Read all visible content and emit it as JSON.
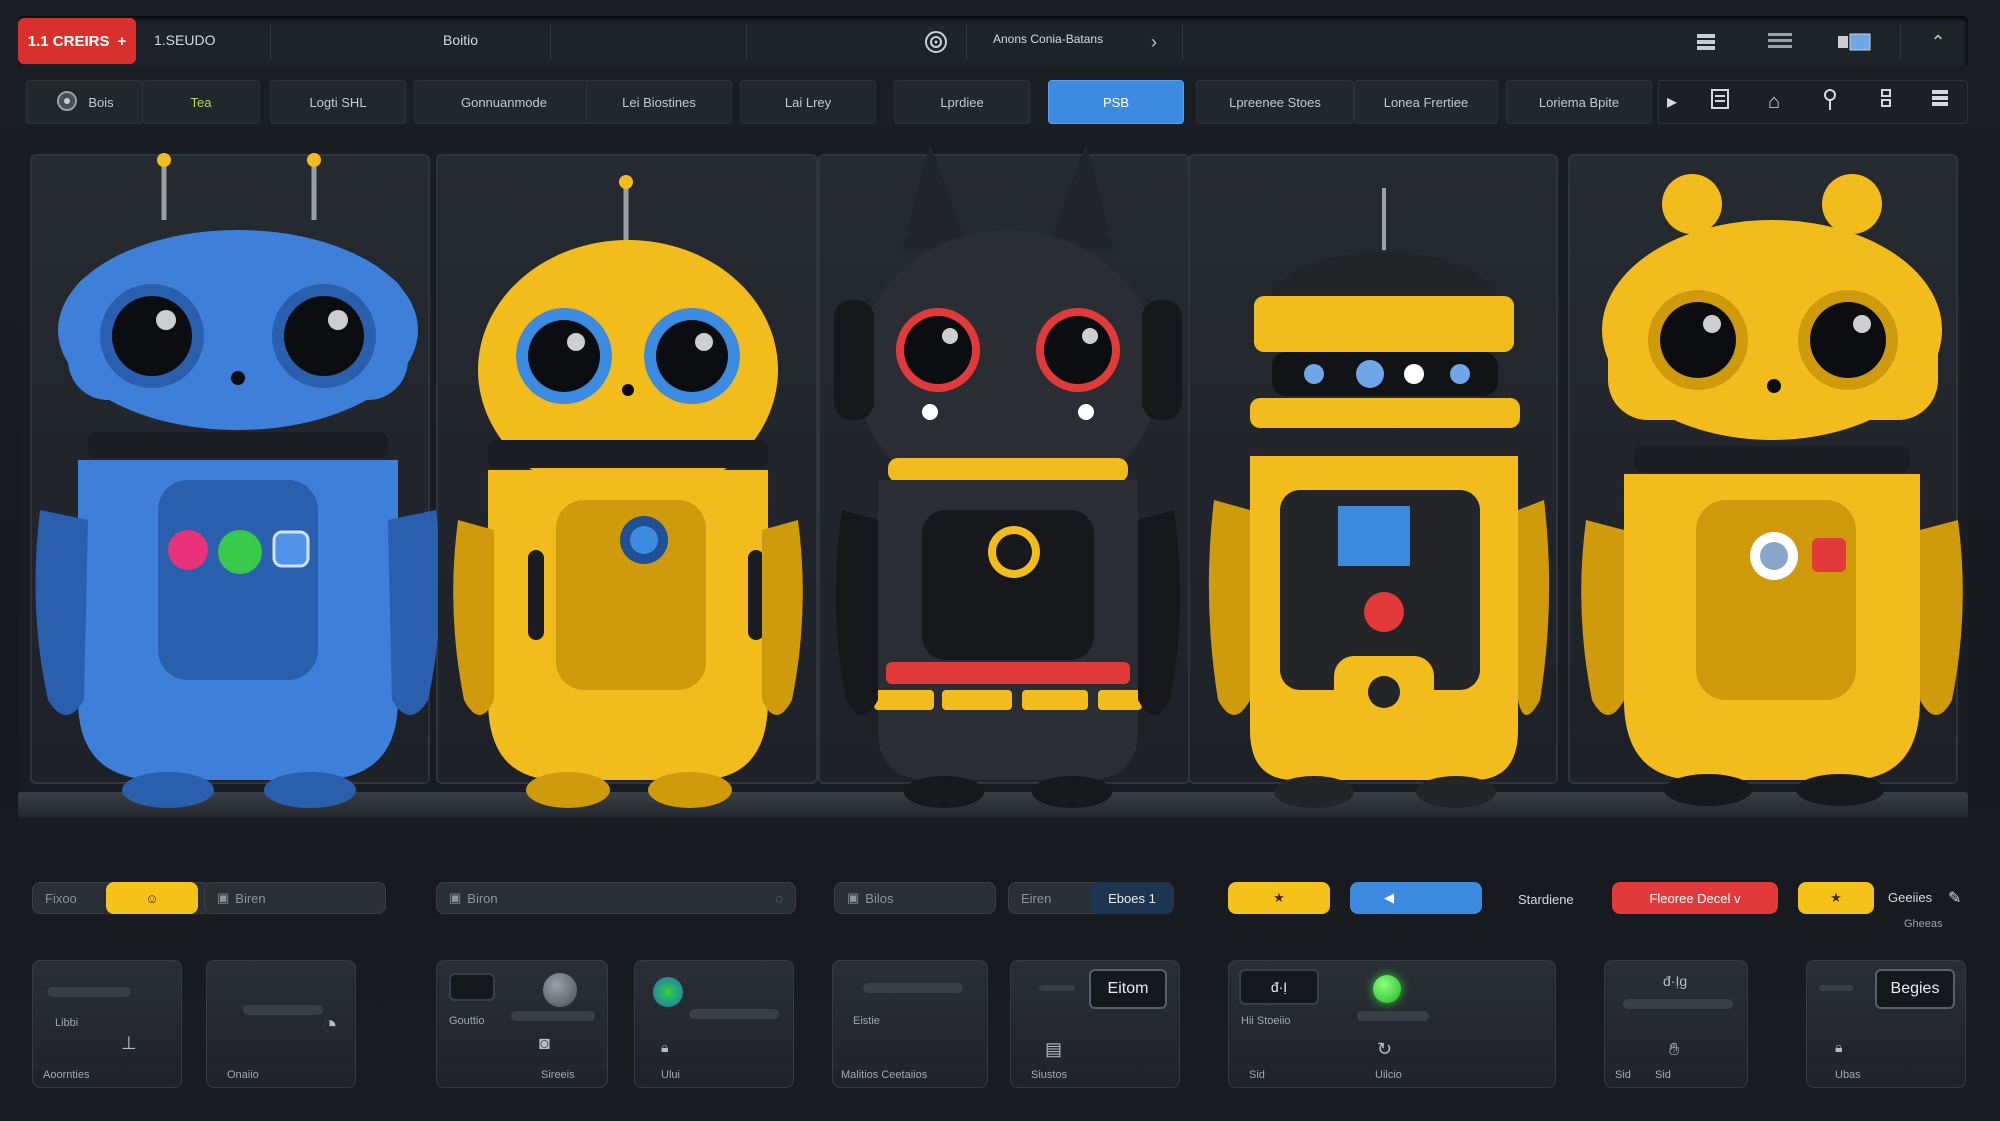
{
  "topbar": {
    "brand_label": "1.1 CREIRS",
    "brand_icon": "plus-icon",
    "studio_label": "1.SEUDO",
    "center_label": "Boitio",
    "search_label": "Anons Conia-Batans",
    "icons": [
      "target-icon",
      "chevron-right-icon",
      "grid-icon",
      "list-icon",
      "window-icon",
      "chevron-updown-icon"
    ]
  },
  "tabs": [
    {
      "label": "Bois",
      "icon": "disc-icon"
    },
    {
      "label": "Tea"
    },
    {
      "label": "Logti SHL"
    },
    {
      "label": "Gonnuanmode"
    },
    {
      "label": "Lei Biostines"
    },
    {
      "label": "Lai Lrey"
    },
    {
      "label": "Lprdiee"
    },
    {
      "label": "PSB"
    },
    {
      "label": "Lpreenee Stoes"
    },
    {
      "label": "Lonea Frertiee"
    },
    {
      "label": "Loriema Bpite"
    }
  ],
  "tab_active_index": 7,
  "right_icons": [
    "play-icon",
    "document-icon",
    "home-icon",
    "pin-icon",
    "adjust-icon",
    "menu-icon"
  ],
  "robots": [
    {
      "name": "blue-robot",
      "body": "#3d7fd9",
      "dark": "#2a5fae",
      "accent": "#1f4f95"
    },
    {
      "name": "yellow-robot",
      "body": "#f2bd1c",
      "dark": "#cf9a0c",
      "accent": "#3d8be0"
    },
    {
      "name": "black-robot",
      "body": "#2a2d33",
      "dark": "#16181c",
      "accent": "#e23a3a"
    },
    {
      "name": "yellow-square-robot",
      "body": "#f2bd1c",
      "dark": "#cf9a0c",
      "accent": "#232529"
    },
    {
      "name": "yellow-bear-robot",
      "body": "#f2bd1c",
      "dark": "#cf9a0c",
      "accent": "#e23a3a"
    }
  ],
  "controls": {
    "field1_label": "Fixoo",
    "field2_label": "Biren",
    "field3_label": "Biron",
    "field4_label": "Bilos",
    "field5_label": "Eiren",
    "field5_value": "Eboes 1",
    "yellow_btn_label": "★",
    "blue_label": "Stardiene",
    "red_btn_label": "Fleoree Decel v",
    "yellow_btn2_label": "★",
    "right_label1": "Geeiies",
    "right_label2": "Gheeas"
  },
  "widgets": [
    {
      "top_label": "Libbi",
      "bottom_label": "Aoornties"
    },
    {
      "bottom_label": "Onaiio"
    },
    {
      "top_label": "Gouttio",
      "bottom_label": "Sireeis"
    },
    {
      "bottom_label": "Ului"
    },
    {
      "top_label": "Eistie",
      "bottom_label": "Malitios Ceetaiios"
    },
    {
      "button_label": "Eitom",
      "bottom_label": "Siustos"
    },
    {
      "top_label": "Hii Stoeiio",
      "display_label": "đ·Ị",
      "bottom_label": "Uilcio",
      "side_label": "Sid"
    },
    {
      "display_label": "đ·Ịg",
      "left_label": "Sid",
      "right_label": "Sid"
    },
    {
      "button_label": "Begies",
      "bottom_label": "Ubas"
    }
  ]
}
